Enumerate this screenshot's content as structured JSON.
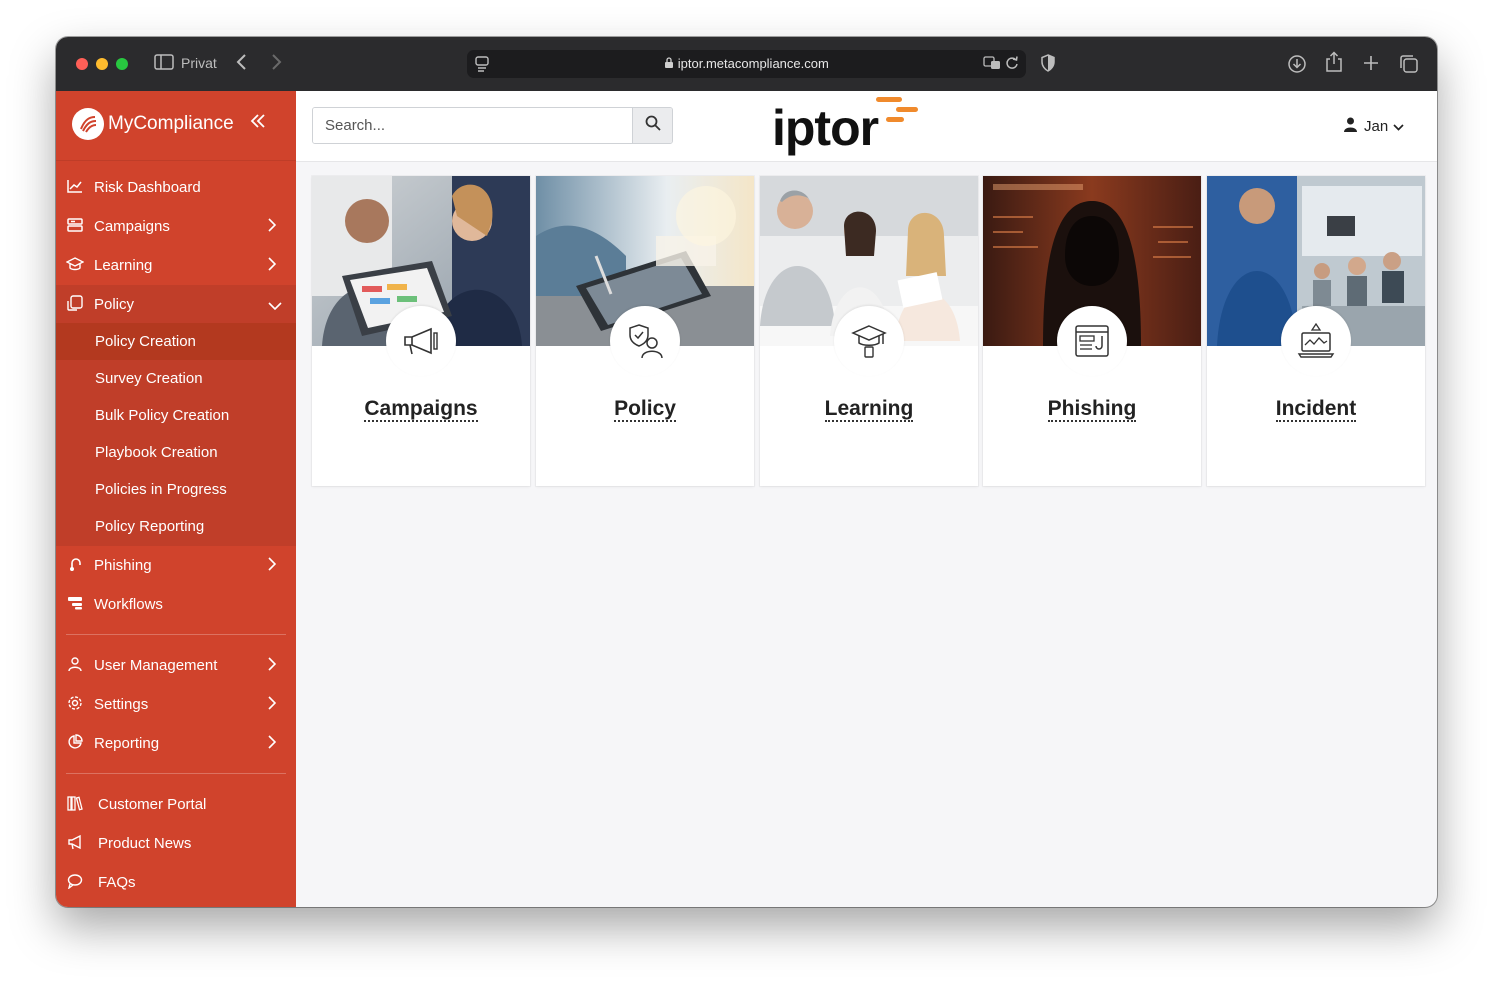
{
  "browser": {
    "profile": "Privat",
    "url": "iptor.metacompliance.com"
  },
  "sidebar": {
    "brand": "MyCompliance",
    "items": [
      {
        "label": "Risk Dashboard"
      },
      {
        "label": "Campaigns"
      },
      {
        "label": "Learning"
      },
      {
        "label": "Policy"
      }
    ],
    "policy_sub": [
      {
        "label": "Policy Creation"
      },
      {
        "label": "Survey Creation"
      },
      {
        "label": "Bulk Policy Creation"
      },
      {
        "label": "Playbook Creation"
      },
      {
        "label": "Policies in Progress"
      },
      {
        "label": "Policy Reporting"
      }
    ],
    "items2": [
      {
        "label": "Phishing"
      },
      {
        "label": "Workflows"
      }
    ],
    "items3": [
      {
        "label": "User Management"
      },
      {
        "label": "Settings"
      },
      {
        "label": "Reporting"
      }
    ],
    "items4": [
      {
        "label": "Customer Portal"
      },
      {
        "label": "Product News"
      },
      {
        "label": "FAQs"
      }
    ]
  },
  "header": {
    "search_placeholder": "Search...",
    "logo_text": "iptor",
    "user_name": "Jan"
  },
  "cards": [
    {
      "title": "Campaigns",
      "icon": "megaphone-icon"
    },
    {
      "title": "Policy",
      "icon": "shield-person-icon"
    },
    {
      "title": "Learning",
      "icon": "graduation-cap-icon"
    },
    {
      "title": "Phishing",
      "icon": "browser-window-icon"
    },
    {
      "title": "Incident",
      "icon": "laptop-alert-icon"
    }
  ],
  "colors": {
    "sidebar": "#d0432c",
    "sidebar_active": "#c03e29",
    "logo_accent": "#f08a2c"
  }
}
